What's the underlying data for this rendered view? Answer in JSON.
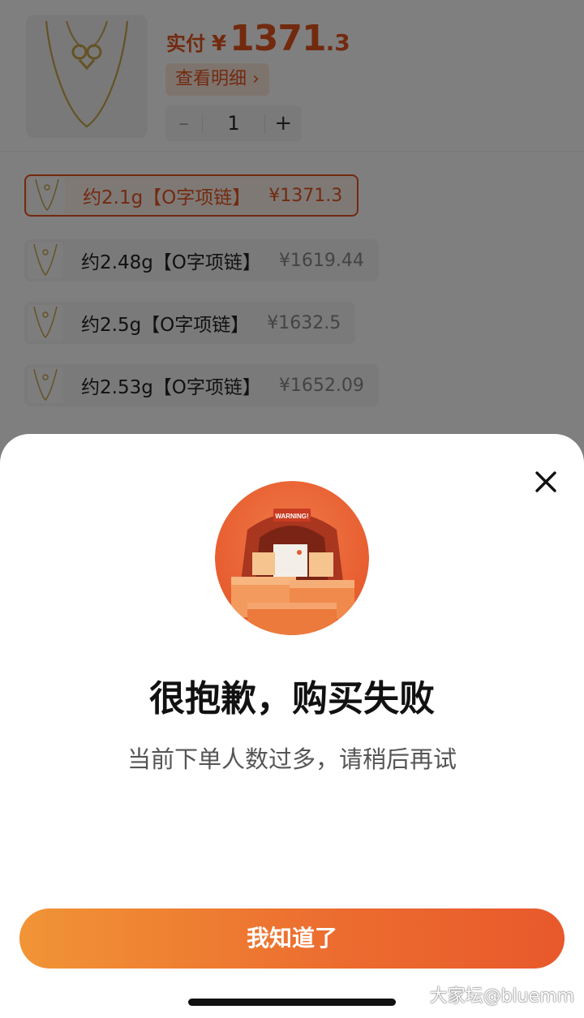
{
  "product": {
    "price_label": "实付",
    "price_currency": "¥",
    "price_int": "1371",
    "price_dec": ".3",
    "detail_link": "查看明细 ›",
    "quantity": "1",
    "minus": "–",
    "plus": "+"
  },
  "options": [
    {
      "name": "约2.1g【O字项链】",
      "price": "¥1371.3",
      "selected": true
    },
    {
      "name": "约2.48g【O字项链】",
      "price": "¥1619.44",
      "selected": false
    },
    {
      "name": "约2.5g【O字项链】",
      "price": "¥1632.5",
      "selected": false
    },
    {
      "name": "约2.53g【O字项链】",
      "price": "¥1652.09",
      "selected": false
    }
  ],
  "modal": {
    "title": "很抱歉，购买失败",
    "subtitle": "当前下单人数过多，请稍后再试",
    "confirm_label": "我知道了",
    "hero_sign": "WARNING!"
  },
  "watermark": "大家坛@bluemm",
  "colors": {
    "accent": "#e4551f",
    "button_start": "#f19436",
    "button_end": "#e8592b"
  }
}
